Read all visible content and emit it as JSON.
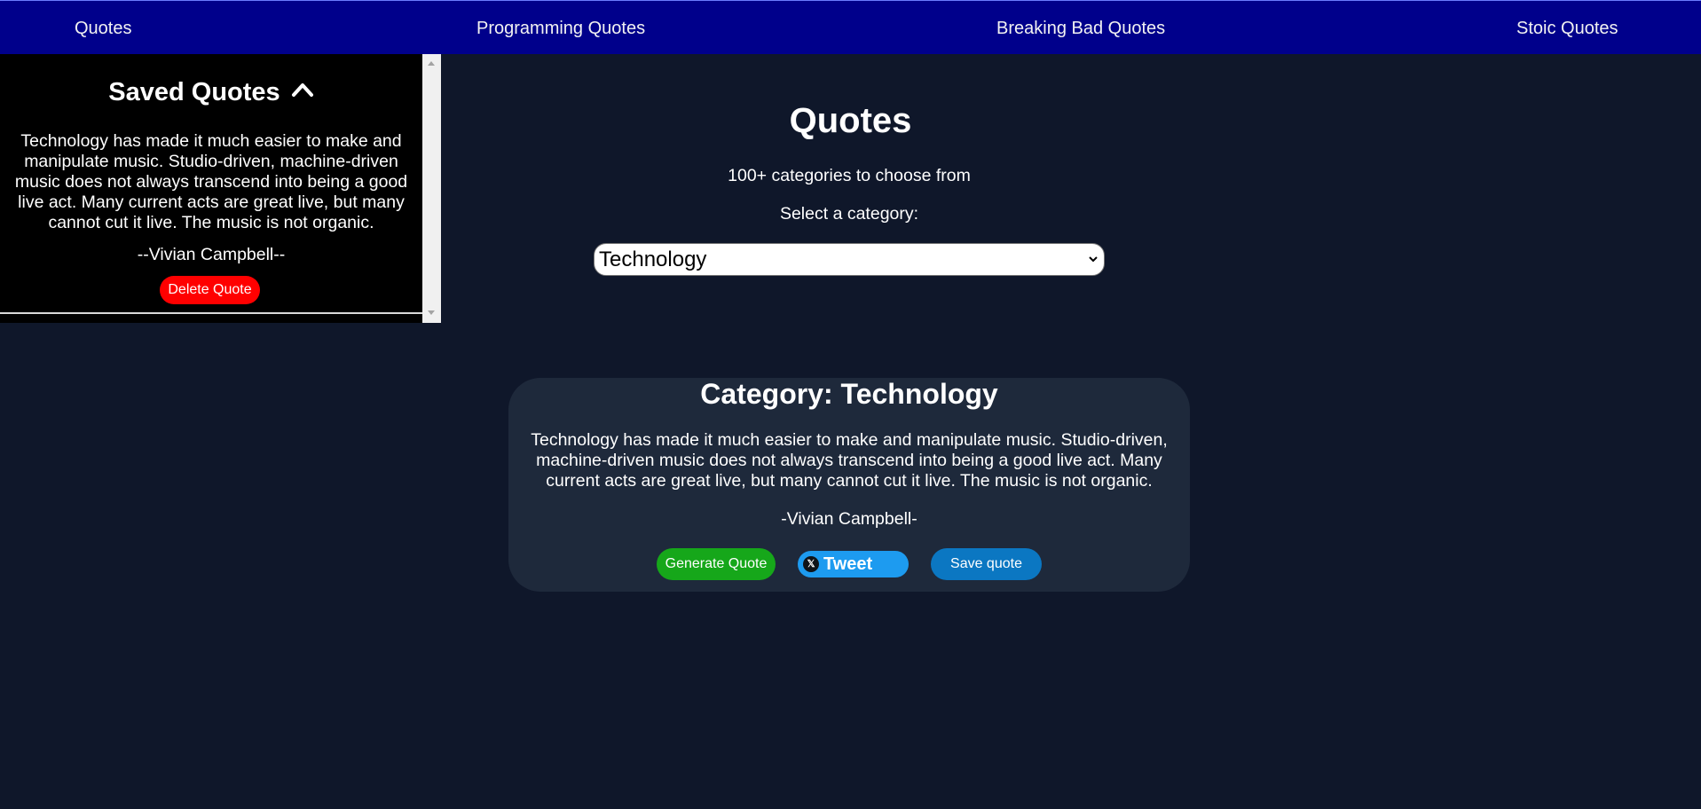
{
  "nav": {
    "items": [
      {
        "label": "Quotes"
      },
      {
        "label": "Programming Quotes"
      },
      {
        "label": "Breaking Bad Quotes"
      },
      {
        "label": "Stoic Quotes"
      }
    ]
  },
  "saved": {
    "title": "Saved Quotes",
    "quote": "Technology has made it much easier to make and manipulate music. Studio-driven, machine-driven music does not always transcend into being a good live act. Many current acts are great live, but many cannot cut it live. The music is not organic.",
    "author": "--Vivian Campbell--",
    "delete_label": "Delete Quote"
  },
  "main": {
    "title": "Quotes",
    "subtitle": "100+ categories to choose from",
    "select_label": "Select a category:",
    "selected_category": "Technology"
  },
  "card": {
    "title": "Category: Technology",
    "quote": "Technology has made it much easier to make and manipulate music. Studio-driven, machine-driven music does not always transcend into being a good live act. Many current acts are great live, but many cannot cut it live. The music is not organic.",
    "author": "-Vivian Campbell-",
    "generate_label": "Generate Quote",
    "tweet_label": "Tweet",
    "tweet_icon_text": "𝕏",
    "save_label": "Save quote"
  },
  "colors": {
    "nav_bg": "#00008b",
    "page_bg": "#0f172a",
    "card_bg": "#1e293b",
    "delete": "#ff0000",
    "generate": "#16a71a",
    "tweet": "#1d9bf0",
    "save": "#0b77c2"
  },
  "icons": {
    "saved_toggle": "chevron-up-icon",
    "select_caret": "chevron-down-icon",
    "tweet": "x-logo-icon"
  }
}
